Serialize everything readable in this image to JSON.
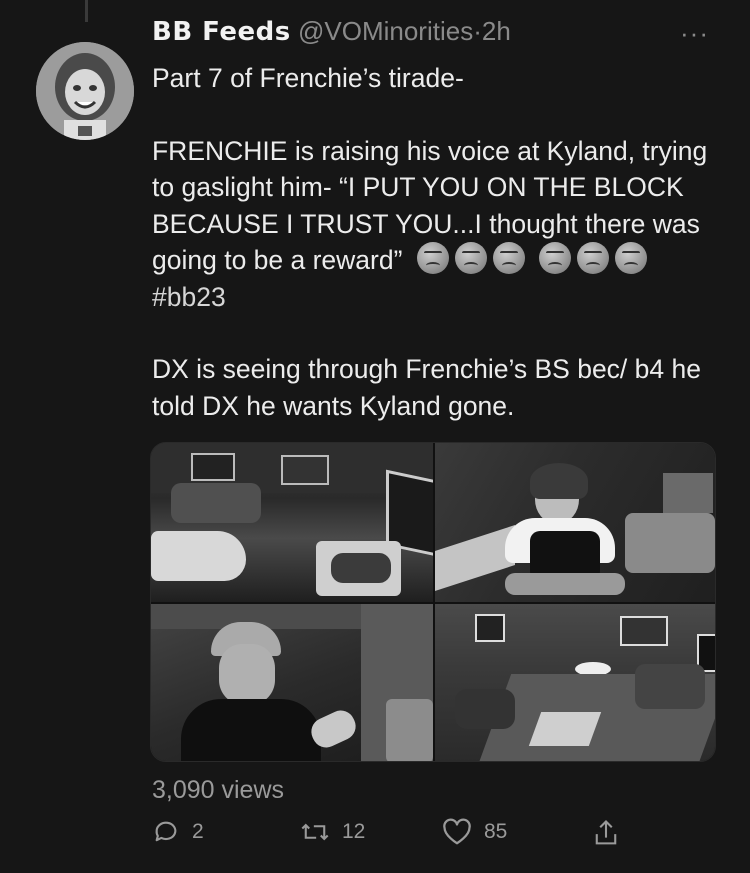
{
  "tweet": {
    "display_name": "BB Feeds",
    "handle": "@VOMinorities",
    "separator": "·",
    "time": "2h",
    "more": "···",
    "line1": "Part 7 of Frenchie’s tirade-",
    "para2_text": "FRENCHIE is raising his voice at Kyland, trying to gaslight him- “I PUT YOU ON THE BLOCK BECAUSE I TRUST YOU...I thought there was going to be a reward”",
    "hashtag": "#bb23",
    "para3": "DX is seeing through Frenchie’s BS bec/ b4 he told DX he wants Kyland gone.",
    "emoji_icon": "angry-face-icon",
    "views": "3,090 views",
    "replies": "2",
    "retweets": "12",
    "likes": "85"
  },
  "icons": [
    "reply-icon",
    "retweet-icon",
    "like-icon",
    "share-icon",
    "more-icon"
  ],
  "colors": {
    "background": "#161616",
    "text": "#e7e7e7",
    "secondary": "#8a8a8a"
  }
}
